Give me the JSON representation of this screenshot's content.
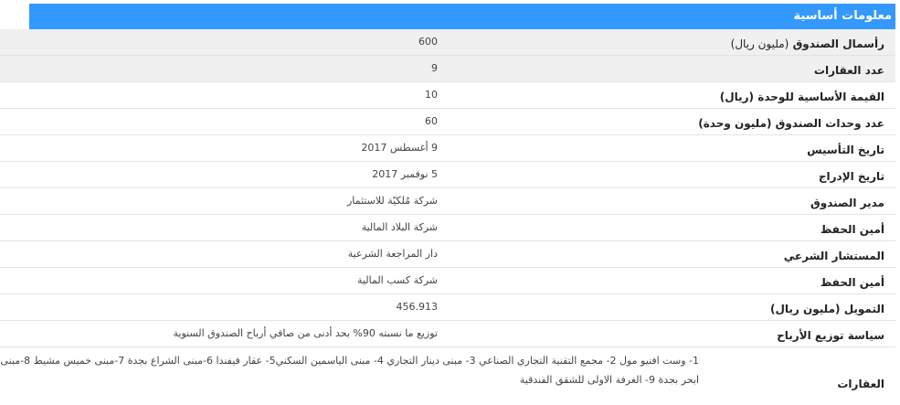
{
  "header": {
    "title": "معلومات أساسية"
  },
  "rows": [
    {
      "label": "رأسمال الصندوق",
      "label_note": "(مليون ريال)",
      "value": "600"
    },
    {
      "label": "عدد العقارات",
      "label_note": "",
      "value": "9"
    },
    {
      "label": "القيمة الأساسية للوحدة",
      "label_note": "(ريال)",
      "value": "10"
    },
    {
      "label": "عدد وحدات الصندوق",
      "label_note": "(مليون وحدة)",
      "value": "60"
    },
    {
      "label": "تاريخ التأسيس",
      "label_note": "",
      "value": "9 أغسطس 2017"
    },
    {
      "label": "تاريخ الإدراج",
      "label_note": "",
      "value": "5 نوفمبر 2017"
    },
    {
      "label": "مدير الصندوق",
      "label_note": "",
      "value": "شركة مُلكيّة للاستثمار"
    },
    {
      "label": "أمين الحفظ",
      "label_note": "",
      "value": "شركة البلاد المالية"
    },
    {
      "label": "المستشار الشرعي",
      "label_note": "",
      "value": "دار المراجعة الشرعية"
    },
    {
      "label": "أمين الحفظ",
      "label_note": "",
      "value": "شركة كسب المالية"
    },
    {
      "label": "التمويل",
      "label_note": "(مليون ريال)",
      "value": "456.913"
    },
    {
      "label": "سياسة توزيع الأرباح",
      "label_note": "",
      "value": "توزيع ما نسبته 90% بحد أدنى من صافي أرباح الصندوق السنوية"
    },
    {
      "label": "العقارات",
      "label_note": "",
      "value": "1- وست افنيو مول 2- مجمع التقنية التجاري الصناعي 3- مبنى دينار التجاري 4- مبنى الياسمين السكني5- عقار فيفندا 6-مبنى الشراع بجدة 7-مبنى خميس مشيط 8-مبنى ابحر بجدة 9- الغرفة الاولى للشقق الفندقية"
    }
  ]
}
